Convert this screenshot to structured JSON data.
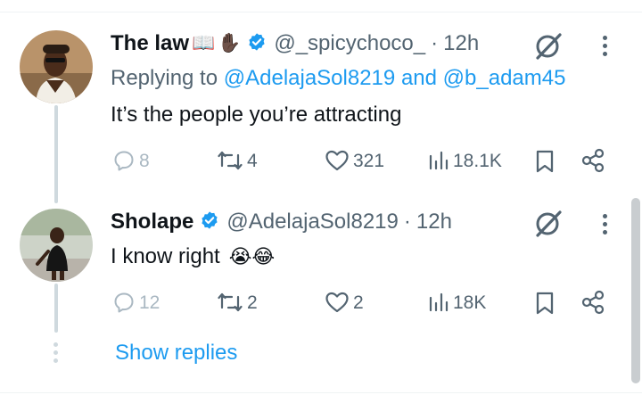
{
  "tweets": [
    {
      "display_name": "The law",
      "name_emojis": [
        "📖",
        "✋🏿"
      ],
      "verified": true,
      "handle": "@_spicychoco_",
      "separator": "·",
      "time": "12h",
      "replying_prefix": "Replying to",
      "replying_to": [
        "@AdelajaSol8219",
        "@b_adam45"
      ],
      "replying_joiner": "and",
      "text": "It’s the people you’re attracting",
      "text_emojis": [],
      "stats": {
        "replies": "8",
        "retweets": "4",
        "likes": "321",
        "views": "18.1K"
      }
    },
    {
      "display_name": "Sholape",
      "name_emojis": [],
      "verified": true,
      "handle": "@AdelajaSol8219",
      "separator": "·",
      "time": "12h",
      "text": "I know right",
      "text_emojis": [
        "😭",
        "😂"
      ],
      "stats": {
        "replies": "12",
        "retweets": "2",
        "likes": "2",
        "views": "18K"
      }
    }
  ],
  "show_replies_label": "Show replies",
  "icons": {
    "reply": "reply-icon",
    "retweet": "retweet-icon",
    "like": "heart-icon",
    "views": "views-icon",
    "bookmark": "bookmark-icon",
    "share": "share-icon",
    "grok": "grok-icon",
    "more": "more-icon"
  },
  "colors": {
    "accent": "#1d9bf0",
    "text": "#0f1419",
    "muted": "#536471",
    "thread_line": "#cfd9de",
    "separator": "#eff3f4"
  }
}
